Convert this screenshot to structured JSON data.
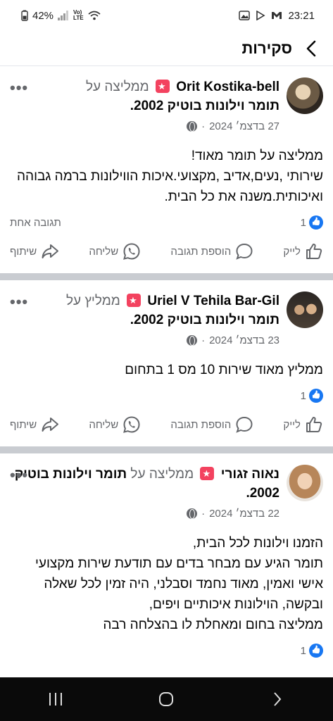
{
  "status_bar": {
    "battery": "42%",
    "net": "Vo)\nLTE",
    "time": "23:21"
  },
  "header": {
    "title": "סקירות"
  },
  "posts": [
    {
      "author": "Orit Kostika-bell",
      "verb": "ממליצה על",
      "page": "תומר וילונות בוטיק 2002.",
      "date": "27 בדצמ׳ 2024",
      "text": "ממליצה על תומר מאוד!\nשירותי ,נעים,אדיב ,מקצועי.איכות הווילונות ברמה גבוהה ואיכותית.משנה את כל הבית.",
      "likes": "1",
      "replies": "תגובה אחת",
      "avatar_color": "#5a4a3a"
    },
    {
      "author": "Uriel V Tehila Bar-Gil",
      "verb": "ממליץ על",
      "page": "תומר וילונות בוטיק 2002.",
      "date": "23 בדצמ׳ 2024",
      "text": "ממליץ מאוד שירות 10 מס 1 בתחום",
      "likes": "1",
      "replies": "",
      "avatar_color": "#3b3530"
    },
    {
      "author": "נאוה זגורי",
      "verb": "ממליצה על",
      "page": "תומר וילונות בוטיק 2002.",
      "date": "22 בדצמ׳ 2024",
      "text": "הזמנו וילונות לכל הבית,\nתומר הגיע עם מבחר בדים עם תודעת שירות מקצועי אישי ואמין,  מאוד נחמד וסבלני, היה זמין לכל שאלה ובקשה, הוילונות איכותיים ויפים,\nממליצה בחום ומאחלת לו בהצלחה רבה",
      "likes": "1",
      "replies": "",
      "avatar_color": "#c49a6c"
    }
  ],
  "actions": {
    "like": "לייק",
    "comment": "הוספת תגובה",
    "send": "שליחה",
    "share": "שיתוף"
  },
  "more_label": "•••"
}
